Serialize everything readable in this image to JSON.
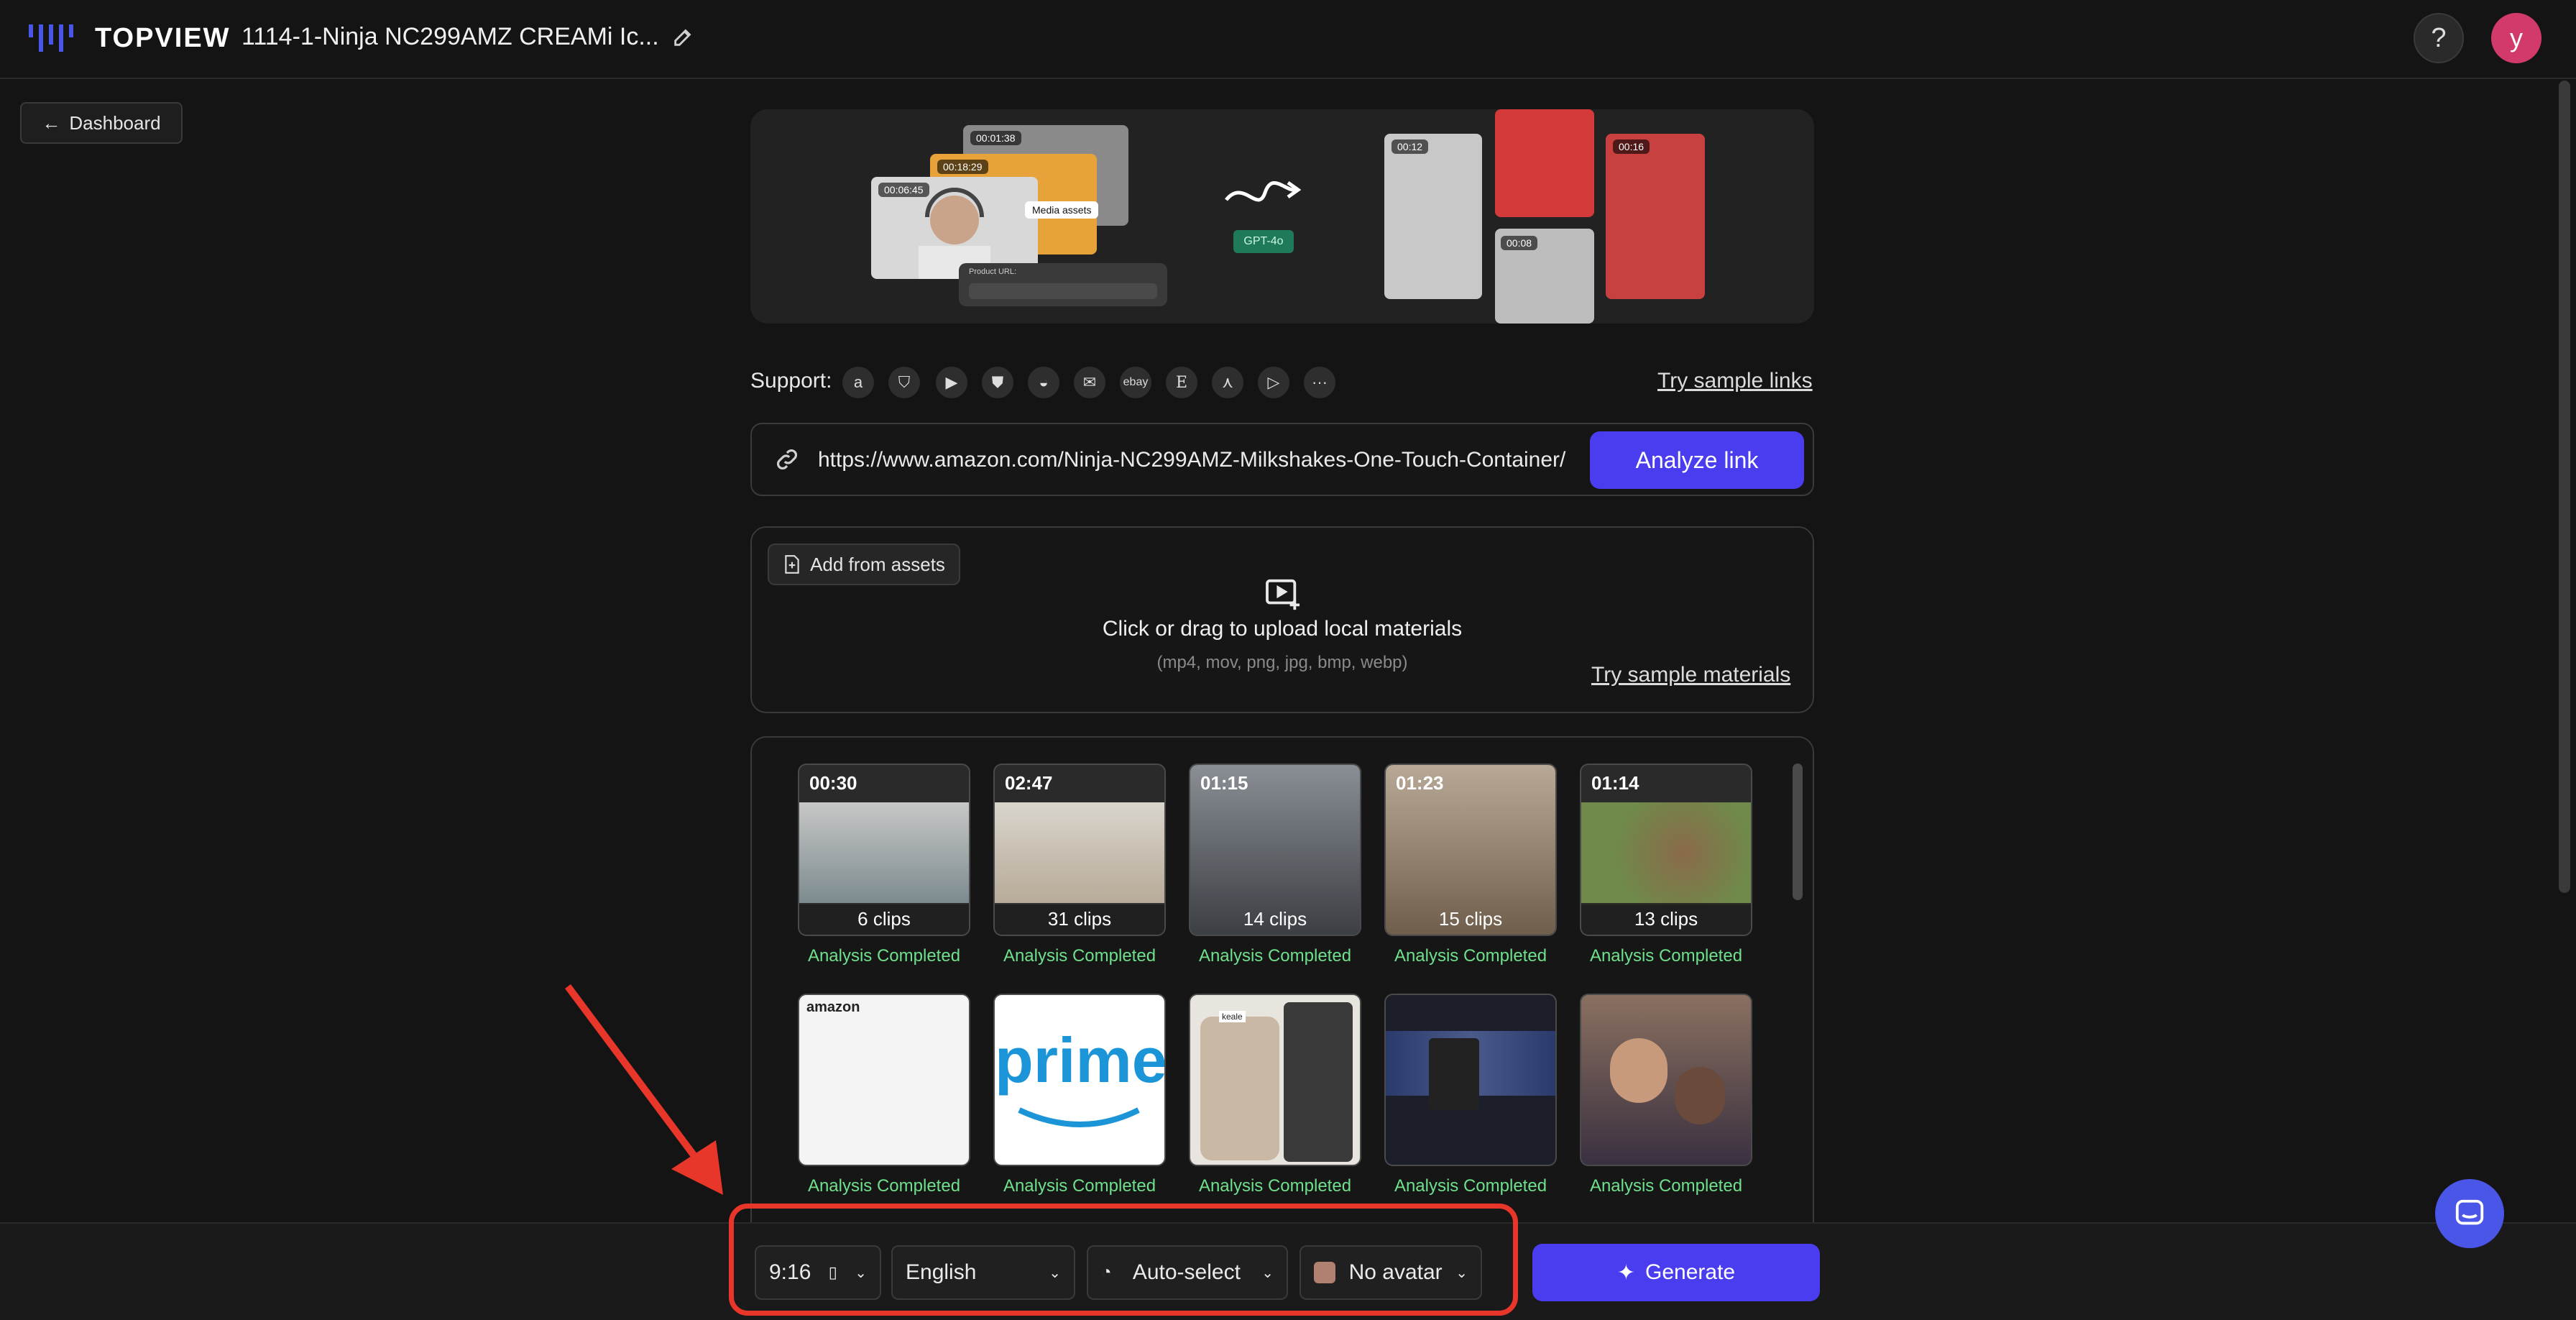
{
  "header": {
    "logo_text": "TOPVIEW",
    "project_title": "1114-1-Ninja NC299AMZ CREAMi Ic...",
    "help_label": "?",
    "avatar_initial": "y"
  },
  "nav": {
    "dashboard_label": "Dashboard"
  },
  "banner": {
    "durations": [
      "00:01:38",
      "00:18:29",
      "00:06:45"
    ],
    "media_assets_label": "Media assets",
    "product_url_label": "Product URL:",
    "gpt_label": "GPT-4o",
    "output_durations": [
      "00:12",
      "00:08",
      "00:16"
    ]
  },
  "support": {
    "label": "Support:",
    "platforms": [
      "amazon-icon",
      "shopify-icon",
      "youtube-icon",
      "shopping-bag-icon",
      "aliexpress-icon",
      "mail-icon",
      "ebay-icon",
      "etsy-icon",
      "app-store-icon",
      "google-play-icon",
      "more-icon"
    ],
    "ebay_text": "ebay",
    "etsy_text": "E",
    "more_text": "···",
    "try_sample_links": "Try sample links"
  },
  "url_bar": {
    "value": "https://www.amazon.com/Ninja-NC299AMZ-Milkshakes-One-Touch-Container/",
    "analyze_label": "Analyze link"
  },
  "upload": {
    "add_from_assets": "Add from assets",
    "title": "Click or drag to upload local materials",
    "formats": "(mp4, mov, png, jpg, bmp, webp)",
    "try_sample_materials": "Try sample materials"
  },
  "videos": [
    {
      "duration": "00:30",
      "clips": "6 clips",
      "status": "Analysis Completed"
    },
    {
      "duration": "02:47",
      "clips": "31 clips",
      "status": "Analysis Completed"
    },
    {
      "duration": "01:15",
      "clips": "14 clips",
      "status": "Analysis Completed"
    },
    {
      "duration": "01:23",
      "clips": "15 clips",
      "status": "Analysis Completed"
    },
    {
      "duration": "01:14",
      "clips": "13 clips",
      "status": "Analysis Completed"
    }
  ],
  "images": [
    {
      "status": "Analysis Completed",
      "text": "amazon"
    },
    {
      "status": "Analysis Completed",
      "text": "prime"
    },
    {
      "status": "Analysis Completed",
      "text": "keale"
    },
    {
      "status": "Analysis Completed",
      "text": ""
    },
    {
      "status": "Analysis Completed",
      "text": ""
    }
  ],
  "bottom": {
    "aspect_ratio": "9:16",
    "language": "English",
    "voice": "Auto-select",
    "avatar": "No avatar",
    "generate_label": "Generate"
  },
  "colors": {
    "accent": "#4a3df0",
    "status_green": "#6ee08c",
    "highlight_red": "#e8362a",
    "avatar_pink": "#d23a6a"
  }
}
